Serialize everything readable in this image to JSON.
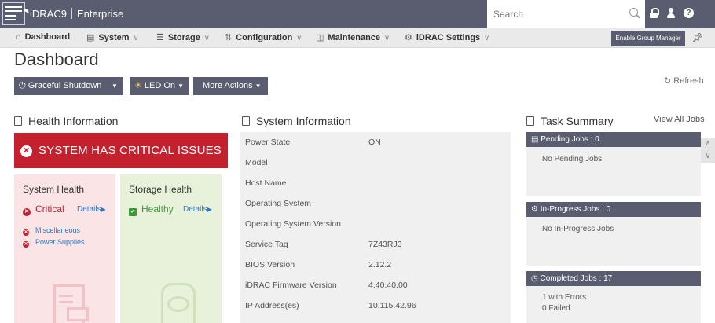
{
  "header": {
    "app_name": "iDRAC9",
    "edition": "Enterprise",
    "search_placeholder": "Search",
    "help_glyph": "?"
  },
  "nav": {
    "items": [
      {
        "label": "Dashboard",
        "icon": "home-icon"
      },
      {
        "label": "System",
        "icon": "system-icon"
      },
      {
        "label": "Storage",
        "icon": "storage-icon"
      },
      {
        "label": "Configuration",
        "icon": "configuration-icon"
      },
      {
        "label": "Maintenance",
        "icon": "maintenance-icon"
      },
      {
        "label": "iDRAC Settings",
        "icon": "idrac-settings-icon"
      }
    ],
    "group_manager_button": "Enable Group Manager"
  },
  "page": {
    "title": "Dashboard",
    "actions": {
      "shutdown": "Graceful Shutdown",
      "led": "LED On",
      "more": "More Actions"
    },
    "refresh": "Refresh"
  },
  "health": {
    "title": "Health Information",
    "banner": "SYSTEM HAS CRITICAL ISSUES",
    "system": {
      "title": "System Health",
      "status": "Critical",
      "details": "Details",
      "issues": [
        "Miscellaneous",
        "Power Supplies"
      ]
    },
    "storage": {
      "title": "Storage Health",
      "status": "Healthy",
      "details": "Details"
    }
  },
  "system_info": {
    "title": "System Information",
    "rows": [
      {
        "label": "Power State",
        "value": "ON"
      },
      {
        "label": "Model",
        "value": ""
      },
      {
        "label": "Host Name",
        "value": ""
      },
      {
        "label": "Operating System",
        "value": ""
      },
      {
        "label": "Operating System Version",
        "value": ""
      },
      {
        "label": "Service Tag",
        "value": "7Z43RJ3"
      },
      {
        "label": "BIOS Version",
        "value": "2.12.2"
      },
      {
        "label": "iDRAC Firmware Version",
        "value": "4.40.40.00"
      },
      {
        "label": "IP Address(es)",
        "value": "10.115.42.96"
      }
    ]
  },
  "tasks": {
    "title": "Task Summary",
    "view_all": "View All Jobs",
    "pending": {
      "header": "Pending Jobs : 0",
      "text": "No Pending Jobs"
    },
    "in_progress": {
      "header": "In-Progress Jobs : 0",
      "text": "No In-Progress Jobs"
    },
    "completed": {
      "header": "Completed Jobs : 17",
      "lines": [
        "1 with Errors",
        "0 Failed"
      ]
    }
  },
  "colors": {
    "header_bg": "#5a5d70",
    "critical": "#c4212f",
    "healthy": "#3d9a39",
    "link": "#2a78c4"
  }
}
